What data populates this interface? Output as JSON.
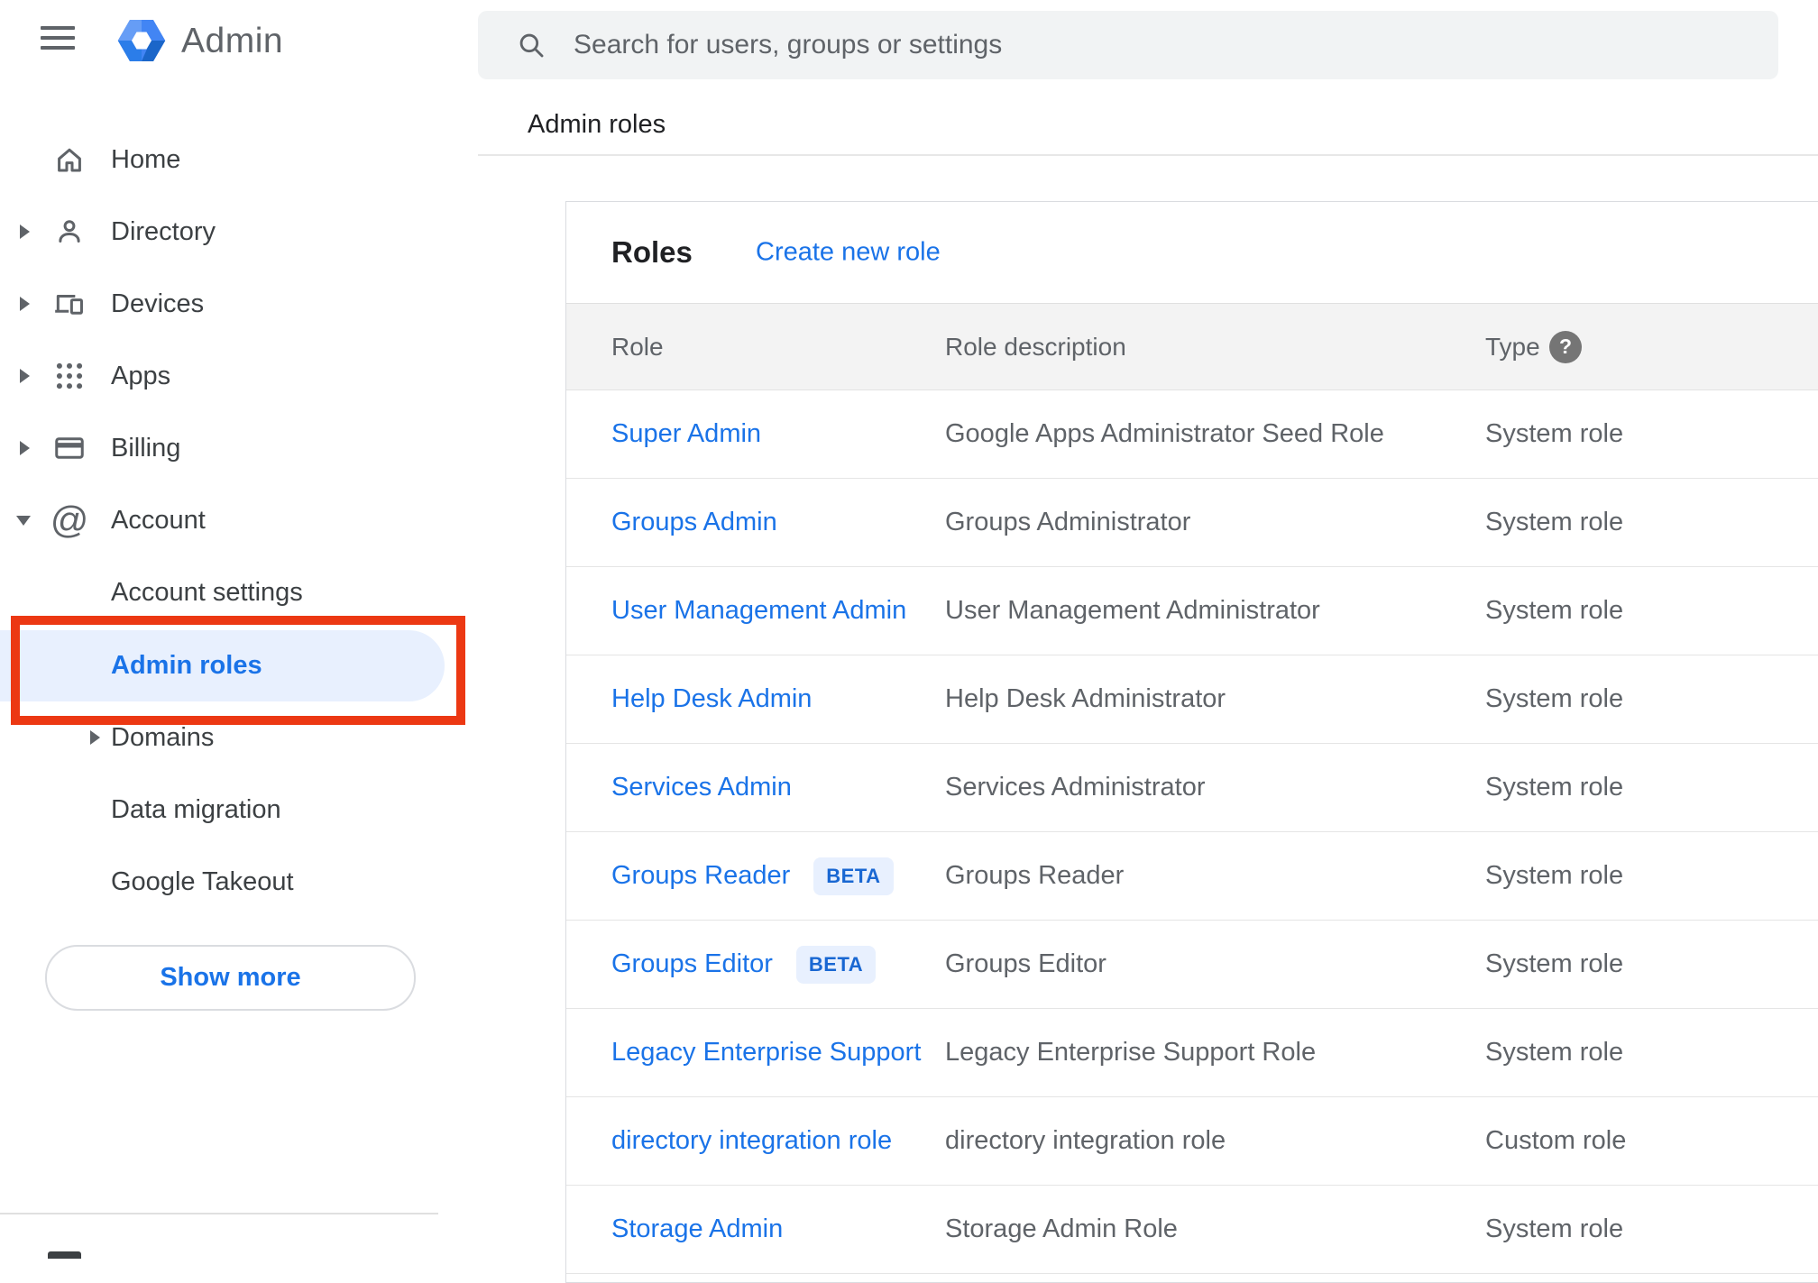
{
  "header": {
    "app_title": "Admin",
    "search_placeholder": "Search for users, groups or settings"
  },
  "breadcrumb": {
    "label": "Admin roles"
  },
  "sidebar": {
    "items": [
      {
        "label": "Home",
        "icon": "home-icon",
        "expand": "none"
      },
      {
        "label": "Directory",
        "icon": "person-icon",
        "expand": "collapsed"
      },
      {
        "label": "Devices",
        "icon": "devices-icon",
        "expand": "collapsed"
      },
      {
        "label": "Apps",
        "icon": "apps-grid-icon",
        "expand": "collapsed"
      },
      {
        "label": "Billing",
        "icon": "credit-card-icon",
        "expand": "collapsed"
      },
      {
        "label": "Account",
        "icon": "at-sign-icon",
        "expand": "expanded"
      }
    ],
    "account_children": [
      {
        "label": "Account settings",
        "selected": false
      },
      {
        "label": "Admin roles",
        "selected": true
      },
      {
        "label": "Domains",
        "expand": "collapsed",
        "selected": false
      },
      {
        "label": "Data migration",
        "selected": false
      },
      {
        "label": "Google Takeout",
        "selected": false
      }
    ],
    "show_more_label": "Show more"
  },
  "main": {
    "card_title": "Roles",
    "create_link_label": "Create new role",
    "table": {
      "columns": [
        "Role",
        "Role description",
        "Type"
      ],
      "type_help_glyph": "?",
      "rows": [
        {
          "role": "Super Admin",
          "description": "Google Apps Administrator Seed Role",
          "type": "System role"
        },
        {
          "role": "Groups Admin",
          "description": "Groups Administrator",
          "type": "System role"
        },
        {
          "role": "User Management Admin",
          "description": "User Management Administrator",
          "type": "System role"
        },
        {
          "role": "Help Desk Admin",
          "description": "Help Desk Administrator",
          "type": "System role"
        },
        {
          "role": "Services Admin",
          "description": "Services Administrator",
          "type": "System role"
        },
        {
          "role": "Groups Reader",
          "beta_label": "BETA",
          "description": "Groups Reader",
          "type": "System role"
        },
        {
          "role": "Groups Editor",
          "beta_label": "BETA",
          "description": "Groups Editor",
          "type": "System role"
        },
        {
          "role": "Legacy Enterprise Support",
          "description": "Legacy Enterprise Support Role",
          "type": "System role"
        },
        {
          "role": "directory integration role",
          "description": "directory integration role",
          "type": "Custom role"
        },
        {
          "role": "Storage Admin",
          "description": "Storage Admin Role",
          "type": "System role"
        }
      ]
    }
  },
  "colors": {
    "accent_blue": "#1a73e8",
    "selected_item_bg": "#e8f0fe",
    "annotation_red": "#ec3813",
    "beta_badge_bg": "#e8f0fe",
    "beta_badge_text": "#1967d2",
    "table_header_bg": "#f3f3f3",
    "icon_gray": "#5f6368"
  }
}
